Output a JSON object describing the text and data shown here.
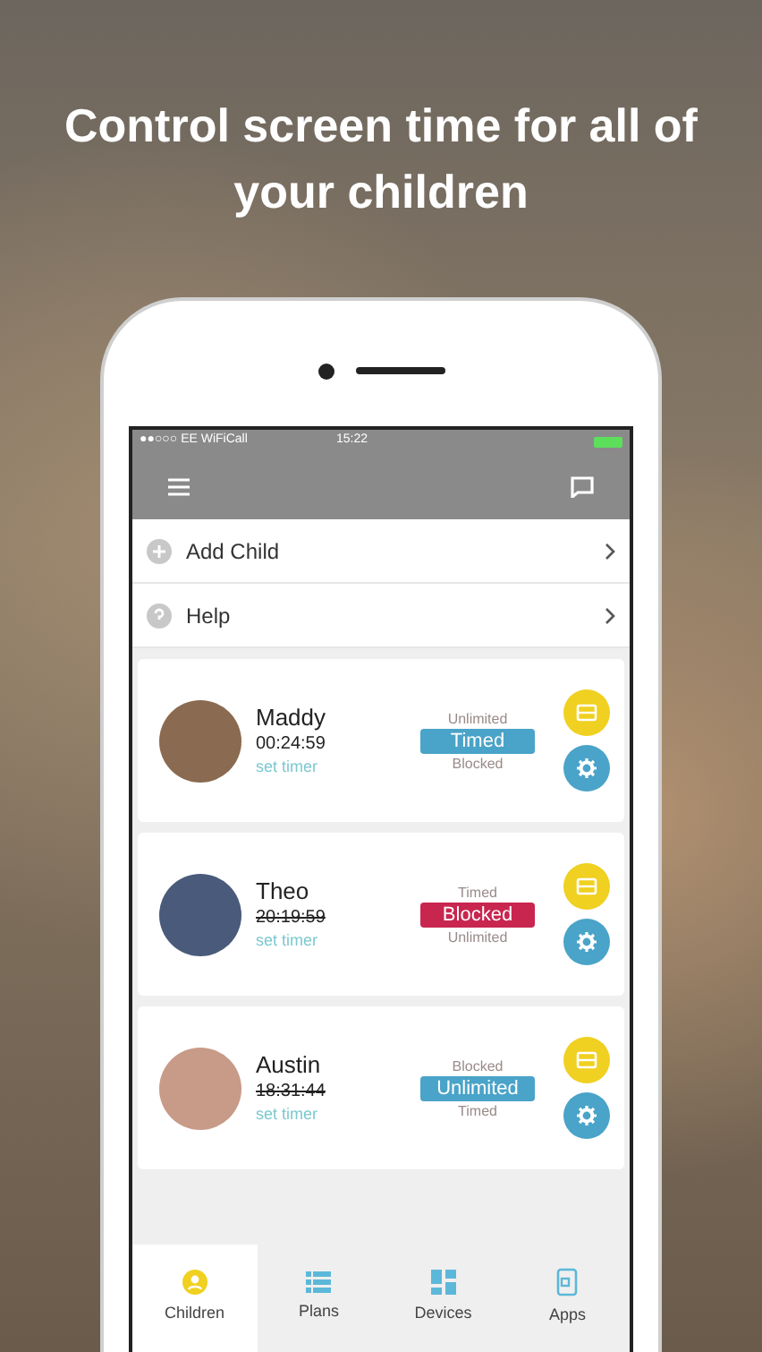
{
  "headline": "Control screen time for all of your children",
  "status_bar": {
    "carrier": "●●○○○ EE WiFiCall",
    "time": "15:22"
  },
  "menu": [
    {
      "label": "Add Child",
      "kind": "add"
    },
    {
      "label": "Help",
      "kind": "help"
    }
  ],
  "children": [
    {
      "name": "Maddy",
      "timer": "00:24:59",
      "timer_active": true,
      "action": "set timer",
      "mode_above": "Unlimited",
      "mode": "Timed",
      "kind": "timed",
      "mode_below": "Blocked"
    },
    {
      "name": "Theo",
      "timer": "20:19:59",
      "timer_active": false,
      "action": "set timer",
      "mode_above": "Timed",
      "mode": "Blocked",
      "kind": "blocked",
      "mode_below": "Unlimited"
    },
    {
      "name": "Austin",
      "timer": "18:31:44",
      "timer_active": false,
      "action": "set timer",
      "mode_above": "Blocked",
      "mode": "Unlimited",
      "kind": "unlimited",
      "mode_below": "Timed"
    }
  ],
  "tabs": [
    {
      "label": "Children",
      "kind": "children",
      "selected": true
    },
    {
      "label": "Plans",
      "kind": "plans",
      "selected": false
    },
    {
      "label": "Devices",
      "kind": "devices",
      "selected": false
    },
    {
      "label": "Apps",
      "kind": "apps",
      "selected": false
    }
  ]
}
